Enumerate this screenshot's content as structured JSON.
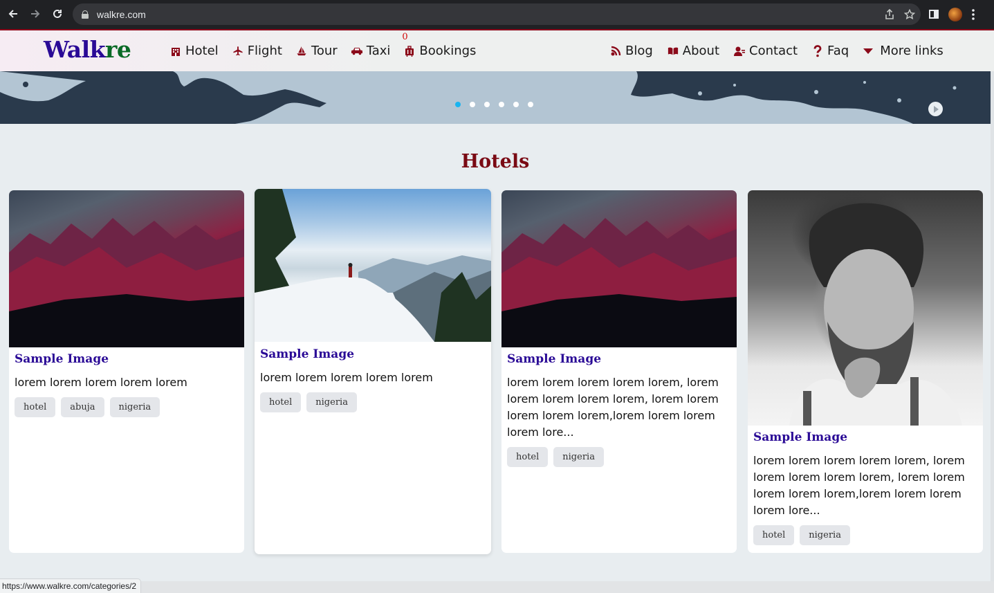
{
  "browser": {
    "url": "walkre.com",
    "status_url": "https://www.walkre.com/categories/2"
  },
  "site": {
    "logo_walk": "Walk",
    "logo_re": "re"
  },
  "nav_left": [
    {
      "label": "Hotel",
      "icon": "hotel-icon"
    },
    {
      "label": "Flight",
      "icon": "plane-icon"
    },
    {
      "label": "Tour",
      "icon": "sailboat-icon"
    },
    {
      "label": "Taxi",
      "icon": "car-icon"
    },
    {
      "label": "Bookings",
      "icon": "luggage-icon",
      "count": "0"
    }
  ],
  "nav_right": [
    {
      "label": "Blog",
      "icon": "blog-icon"
    },
    {
      "label": "About",
      "icon": "book-icon"
    },
    {
      "label": "Contact",
      "icon": "contact-icon"
    },
    {
      "label": "Faq",
      "icon": "question-icon"
    },
    {
      "label": "More links",
      "icon": "caret-down-icon"
    }
  ],
  "carousel": {
    "slide_count": 6,
    "active_index": 0,
    "colors": {
      "active": "#19b4f0",
      "inactive": "#ffffff"
    }
  },
  "section": {
    "title": "Hotels"
  },
  "cards": [
    {
      "title": "Sample Image",
      "description": "lorem lorem lorem lorem lorem",
      "tags": [
        "hotel",
        "abuja",
        "nigeria"
      ],
      "image": "mountain-photo"
    },
    {
      "title": "Sample Image",
      "description": "lorem lorem lorem lorem lorem",
      "tags": [
        "hotel",
        "nigeria"
      ],
      "image": "snow-hiker-photo"
    },
    {
      "title": "Sample Image",
      "description": "lorem lorem lorem lorem lorem, lorem lorem lorem lorem lorem, lorem lorem lorem lorem lorem,lorem lorem lorem lorem lore...",
      "tags": [
        "hotel",
        "nigeria"
      ],
      "image": "mountain-photo"
    },
    {
      "title": "Sample Image",
      "description": "lorem lorem lorem lorem lorem, lorem lorem lorem lorem lorem, lorem lorem lorem lorem lorem,lorem lorem lorem lorem lore...",
      "tags": [
        "hotel",
        "nigeria"
      ],
      "image": "bearded-man-photo"
    }
  ],
  "colors": {
    "brand_dark_red": "#7a0a14",
    "brand_purple": "#2a0a96",
    "brand_green": "#0a6a26",
    "icon_red": "#8b0a1a"
  }
}
